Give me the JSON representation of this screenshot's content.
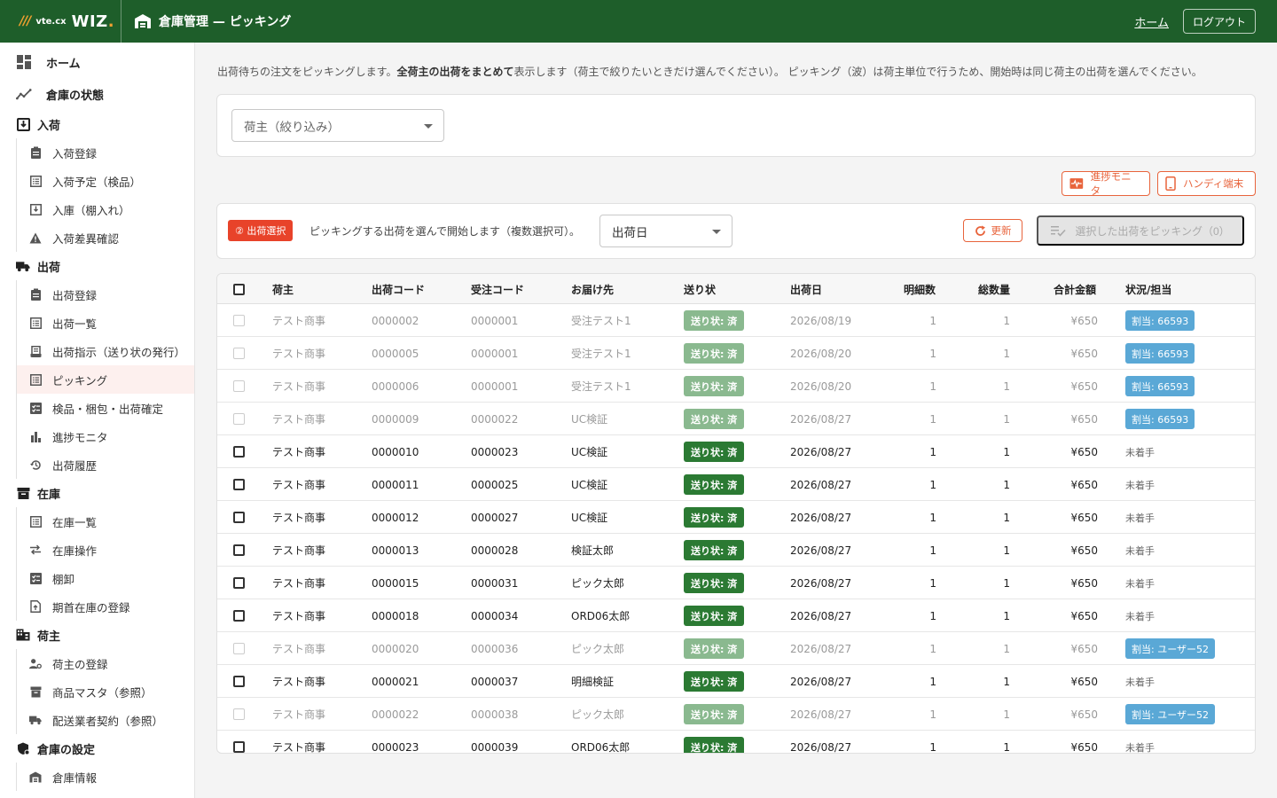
{
  "header": {
    "logo_mark": "///",
    "logo_vte": "vte.cx",
    "logo_wiz": "WIZ",
    "logo_dot": ".",
    "title": "倉庫管理 — ピッキング",
    "home_link": "ホーム",
    "logout": "ログアウト",
    "bg_color": "#1e5e2a"
  },
  "sidebar": {
    "home": "ホーム",
    "warehouse_status": "倉庫の状態",
    "inbound": {
      "label": "入荷",
      "items": [
        "入荷登録",
        "入荷予定（検品）",
        "入庫（棚入れ）",
        "入荷差異確認"
      ]
    },
    "outbound": {
      "label": "出荷",
      "items": [
        "出荷登録",
        "出荷一覧",
        "出荷指示（送り状の発行）",
        "ピッキング",
        "検品・梱包・出荷確定",
        "進捗モニタ",
        "出荷履歴"
      ]
    },
    "inventory": {
      "label": "在庫",
      "items": [
        "在庫一覧",
        "在庫操作",
        "棚卸",
        "期首在庫の登録"
      ]
    },
    "shipper": {
      "label": "荷主",
      "items": [
        "荷主の登録",
        "商品マスタ（参照）",
        "配送業者契約（参照）"
      ]
    },
    "settings": {
      "label": "倉庫の設定",
      "items": [
        "倉庫情報"
      ]
    }
  },
  "main": {
    "desc_pre": "出荷待ちの注文をピッキングします。",
    "desc_bold": "全荷主の出荷をまとめて",
    "desc_post": "表示します（荷主で絞りたいときだけ選んでください）。 ピッキング（波）は荷主単位で行うため、開始時は同じ荷主の出荷を選んでください。",
    "shipper_filter_placeholder": "荷主（絞り込み）",
    "progress_monitor_btn": "進捗モニタ",
    "handy_btn": "ハンディ端末",
    "step_badge": "② 出荷選択",
    "step_text": "ピッキングする出荷を選んで開始します（複数選択可）。",
    "sort_select": "出荷日",
    "refresh_btn": "更新",
    "pick_btn": "選択した出荷をピッキング（0）",
    "accent_color": "#e8643c"
  },
  "table": {
    "headers": [
      "荷主",
      "出荷コード",
      "受注コード",
      "お届け先",
      "送り状",
      "出荷日",
      "明細数",
      "総数量",
      "合計金額",
      "状況/担当"
    ],
    "rows": [
      {
        "shipper": "テスト商事",
        "ship_code": "0000002",
        "order_code": "0000001",
        "dest": "受注テスト1",
        "label": "送り状: 済",
        "date": "2026/08/19",
        "lines": "1",
        "qty": "1",
        "amount": "¥650",
        "status": "割当: 66593"
      },
      {
        "shipper": "テスト商事",
        "ship_code": "0000005",
        "order_code": "0000001",
        "dest": "受注テスト1",
        "label": "送り状: 済",
        "date": "2026/08/20",
        "lines": "1",
        "qty": "1",
        "amount": "¥650",
        "status": "割当: 66593"
      },
      {
        "shipper": "テスト商事",
        "ship_code": "0000006",
        "order_code": "0000001",
        "dest": "受注テスト1",
        "label": "送り状: 済",
        "date": "2026/08/20",
        "lines": "1",
        "qty": "1",
        "amount": "¥650",
        "status": "割当: 66593"
      },
      {
        "shipper": "テスト商事",
        "ship_code": "0000009",
        "order_code": "0000022",
        "dest": "UC検証",
        "label": "送り状: 済",
        "date": "2026/08/27",
        "lines": "1",
        "qty": "1",
        "amount": "¥650",
        "status": "割当: 66593"
      },
      {
        "shipper": "テスト商事",
        "ship_code": "0000010",
        "order_code": "0000023",
        "dest": "UC検証",
        "label": "送り状: 済",
        "date": "2026/08/27",
        "lines": "1",
        "qty": "1",
        "amount": "¥650",
        "status": "未着手"
      },
      {
        "shipper": "テスト商事",
        "ship_code": "0000011",
        "order_code": "0000025",
        "dest": "UC検証",
        "label": "送り状: 済",
        "date": "2026/08/27",
        "lines": "1",
        "qty": "1",
        "amount": "¥650",
        "status": "未着手"
      },
      {
        "shipper": "テスト商事",
        "ship_code": "0000012",
        "order_code": "0000027",
        "dest": "UC検証",
        "label": "送り状: 済",
        "date": "2026/08/27",
        "lines": "1",
        "qty": "1",
        "amount": "¥650",
        "status": "未着手"
      },
      {
        "shipper": "テスト商事",
        "ship_code": "0000013",
        "order_code": "0000028",
        "dest": "検証太郎",
        "label": "送り状: 済",
        "date": "2026/08/27",
        "lines": "1",
        "qty": "1",
        "amount": "¥650",
        "status": "未着手"
      },
      {
        "shipper": "テスト商事",
        "ship_code": "0000015",
        "order_code": "0000031",
        "dest": "ピック太郎",
        "label": "送り状: 済",
        "date": "2026/08/27",
        "lines": "1",
        "qty": "1",
        "amount": "¥650",
        "status": "未着手"
      },
      {
        "shipper": "テスト商事",
        "ship_code": "0000018",
        "order_code": "0000034",
        "dest": "ORD06太郎",
        "label": "送り状: 済",
        "date": "2026/08/27",
        "lines": "1",
        "qty": "1",
        "amount": "¥650",
        "status": "未着手"
      },
      {
        "shipper": "テスト商事",
        "ship_code": "0000020",
        "order_code": "0000036",
        "dest": "ピック太郎",
        "label": "送り状: 済",
        "date": "2026/08/27",
        "lines": "1",
        "qty": "1",
        "amount": "¥650",
        "status": "割当: ユーザー52"
      },
      {
        "shipper": "テスト商事",
        "ship_code": "0000021",
        "order_code": "0000037",
        "dest": "明細検証",
        "label": "送り状: 済",
        "date": "2026/08/27",
        "lines": "1",
        "qty": "1",
        "amount": "¥650",
        "status": "未着手"
      },
      {
        "shipper": "テスト商事",
        "ship_code": "0000022",
        "order_code": "0000038",
        "dest": "ピック太郎",
        "label": "送り状: 済",
        "date": "2026/08/27",
        "lines": "1",
        "qty": "1",
        "amount": "¥650",
        "status": "割当: ユーザー52"
      },
      {
        "shipper": "テスト商事",
        "ship_code": "0000023",
        "order_code": "0000039",
        "dest": "ORD06太郎",
        "label": "送り状: 済",
        "date": "2026/08/27",
        "lines": "1",
        "qty": "1",
        "amount": "¥650",
        "status": "未着手"
      }
    ]
  }
}
